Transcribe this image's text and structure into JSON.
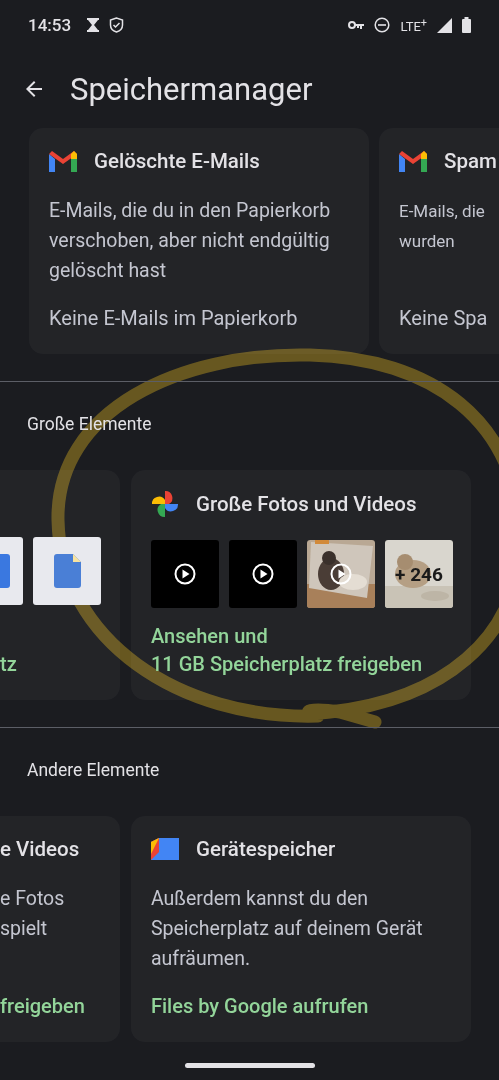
{
  "status_bar": {
    "time": "14:53",
    "network": "LTE$^{+}$"
  },
  "app_bar": {
    "title": "Speichermanager"
  },
  "sections": [
    {
      "cards": [
        {
          "kind": "full",
          "title": "Gelöschte E-Mails",
          "description": "E-Mails, die du in den Papierkorb verschoben, aber nicht endgültig gelöscht hast",
          "footer": "Keine E-Mails im Papierkorb",
          "action": false
        },
        {
          "kind": "right_cut",
          "title": "Spam",
          "description": "E-Mails, die\nwurden",
          "footer": "Keine Spa",
          "action": false
        }
      ]
    },
    {
      "heading": "Große Elemente",
      "cards": [
        {
          "kind": "left_cut",
          "thumbnails": [
            {
              "kind": "document_cut"
            },
            {
              "kind": "document"
            }
          ],
          "footer": "tz",
          "action": true
        },
        {
          "kind": "full",
          "title": "Große Fotos und Videos",
          "thumbnails": [
            {
              "kind": "video"
            },
            {
              "kind": "video"
            },
            {
              "kind": "photo_video"
            },
            {
              "kind": "photo_more",
              "label": "+ 246"
            }
          ],
          "footer": "Ansehen und\n11 GB Speicherplatz freigeben",
          "action": true
        }
      ]
    },
    {
      "heading": "Andere Elemente",
      "cards": [
        {
          "kind": "left_cut",
          "title": "e Videos",
          "description": "e Fotos\nspielt",
          "footer": "freigeben",
          "action": true
        },
        {
          "kind": "full",
          "title": "Gerätespeicher",
          "description": "Außerdem kannst du den Speicherplatz auf deinem Gerät aufräumen.",
          "footer": "Files by Google aufrufen",
          "action": true
        }
      ]
    }
  ]
}
